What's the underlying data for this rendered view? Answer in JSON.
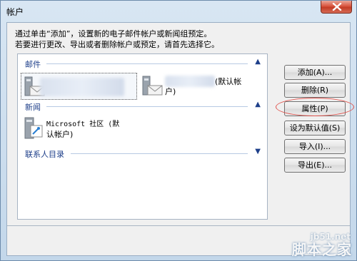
{
  "window": {
    "title": "帐户"
  },
  "instructions": {
    "line1": "通过单击“添加”，设置新的电子邮件帐户或新闻组预定。",
    "line2": "若要进行更改、导出或者删除帐户或预定，请首先选择它。"
  },
  "groups": [
    {
      "label": "邮件",
      "toggle": "⌃",
      "items": [
        {
          "icon": "mail-account-icon",
          "label": ""
        },
        {
          "icon": "mail-account-icon",
          "label_line1": "(默认帐",
          "label_line2": "户)"
        }
      ]
    },
    {
      "label": "新闻",
      "toggle": "⌃",
      "items": [
        {
          "icon": "news-server-icon",
          "label_line1": "Microsoft 社区 (默",
          "label_line2": "认帐户)"
        }
      ]
    },
    {
      "label": "联系人目录",
      "toggle": "⌄",
      "items": []
    }
  ],
  "buttons": {
    "add": "添加(A)...",
    "delete": "删除(R)",
    "properties": "属性(P)",
    "set_default": "设为默认值(S)",
    "import": "导入(I)...",
    "export": "导出(E)..."
  },
  "watermark": {
    "url": "jb51.net",
    "brand": "脚本之家"
  },
  "colors": {
    "highlight_ring": "#e0534d",
    "group_label": "#1e3f8a",
    "close_button": "#c33c26"
  }
}
